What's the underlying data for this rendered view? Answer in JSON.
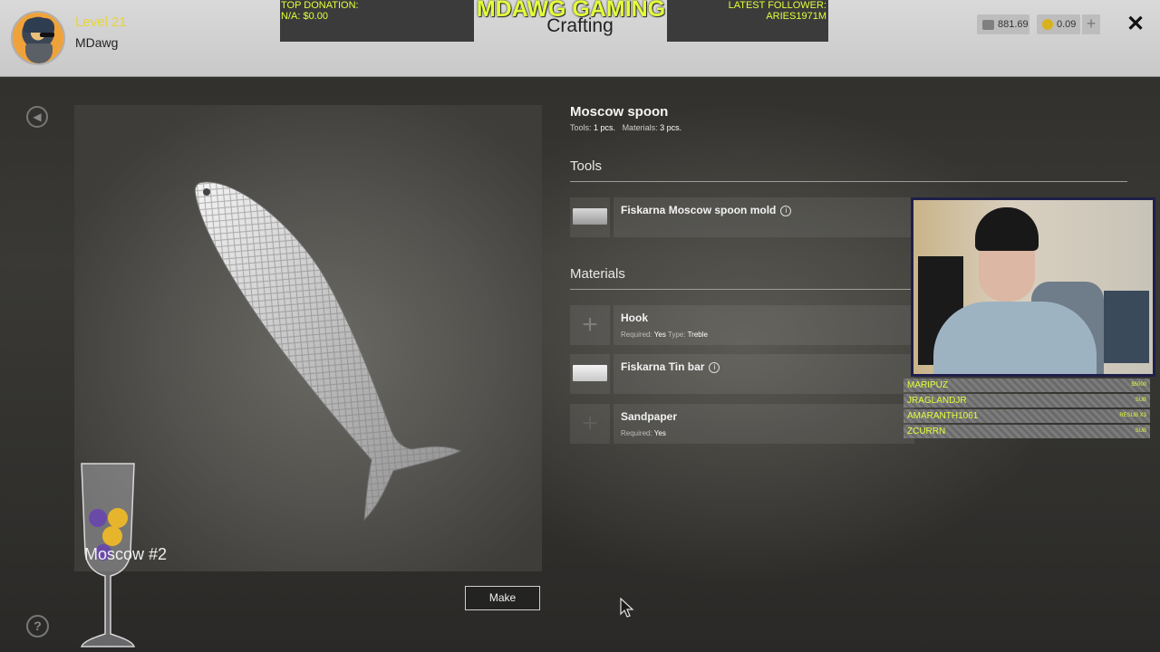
{
  "header": {
    "level": "Level 21",
    "username": "MDawg",
    "top_donation_label": "TOP DONATION:",
    "top_donation_value": "N/A: $0.00",
    "brand": "MDAWG GAMING",
    "screen_title": "Crafting",
    "latest_follower_label": "LATEST FOLLOWER:",
    "latest_follower_value": "ARIES1971M",
    "silver_balance": "881.69",
    "gold_balance": "0.09",
    "plus_symbol": "+",
    "close_symbol": "✕"
  },
  "preview": {
    "label": "Moscow #2",
    "make_button": "Make"
  },
  "item": {
    "title": "Moscow spoon",
    "tools_label": "Tools:",
    "tools_value": "1 pcs.",
    "materials_label": "Materials:",
    "materials_value": "3 pcs."
  },
  "sections": {
    "tools": "Tools",
    "materials": "Materials"
  },
  "tools": [
    {
      "name": "Fiskarna Moscow spoon mold",
      "info": "i"
    }
  ],
  "materials": [
    {
      "name": "Hook",
      "required_label": "Required:",
      "required_value": "Yes",
      "type_label": "Type:",
      "type_value": "Treble"
    },
    {
      "name": "Fiskarna Tin bar",
      "info": "i"
    },
    {
      "name": "Sandpaper",
      "required_label": "Required:",
      "required_value": "Yes"
    }
  ],
  "chat": [
    {
      "name": "MARIPUZ",
      "tag": "$5000"
    },
    {
      "name": "JRAGLANDJR",
      "tag": "SUB"
    },
    {
      "name": "AMARANTH1061",
      "tag": "RESUB x3"
    },
    {
      "name": "ZCURRN",
      "tag": "SUB"
    }
  ],
  "icons": {
    "back": "back-icon",
    "help": "?",
    "silver": "silver-coin-icon",
    "gold": "gold-coin-icon"
  },
  "colors": {
    "overlay_accent": "#e4ff3a",
    "level_text": "#e6d53a"
  }
}
